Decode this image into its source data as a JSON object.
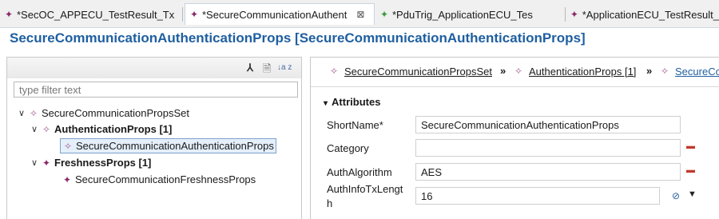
{
  "tabs": [
    {
      "label": "*SecOC_APPECU_TestResult_Tx",
      "icon": "diamond-icon",
      "active": false
    },
    {
      "label": "*SecureCommunicationAuthent",
      "icon": "diamond-icon",
      "active": true,
      "close": "⊠"
    },
    {
      "label": "*PduTrig_ApplicationECU_Tes",
      "icon": "green-diamond-icon",
      "active": false
    },
    {
      "label": "*ApplicationECU_TestResult_",
      "icon": "diamond-icon",
      "active": false
    }
  ],
  "editor": {
    "title": "SecureCommunicationAuthenticationProps [SecureCommunicationAuthenticationProps]"
  },
  "outline": {
    "filter_placeholder": "type filter text",
    "toolbar": {
      "collapse": "⅄",
      "doc": "🗎",
      "sort": "↓a z"
    },
    "tree": [
      {
        "label": "SecureCommunicationPropsSet",
        "expanded": true
      },
      {
        "label": "AuthenticationProps [1]",
        "expanded": true
      },
      {
        "label": "SecureCommunicationAuthenticationProps",
        "selected": true
      },
      {
        "label": "FreshnessProps [1]",
        "expanded": true
      },
      {
        "label": "SecureCommunicationFreshnessProps"
      }
    ]
  },
  "details": {
    "breadcrumbs": [
      "SecureCommunicationPropsSet",
      "AuthenticationProps [1]",
      "SecureCo"
    ],
    "section": "Attributes",
    "fields": [
      {
        "label": "ShortName*",
        "value": "SecureCommunicationAuthenticationProps"
      },
      {
        "label": "Category",
        "value": ""
      },
      {
        "label": "AuthAlgorithm",
        "value": "AES"
      },
      {
        "label": "AuthInfoTxLength",
        "label_line1": "AuthInfoTxLengt",
        "label_line2": "h",
        "value": "16"
      }
    ]
  },
  "colors": {
    "title": "#1f5fa0",
    "selection": "#e5effa",
    "element_icon": "#8a2a6a"
  }
}
